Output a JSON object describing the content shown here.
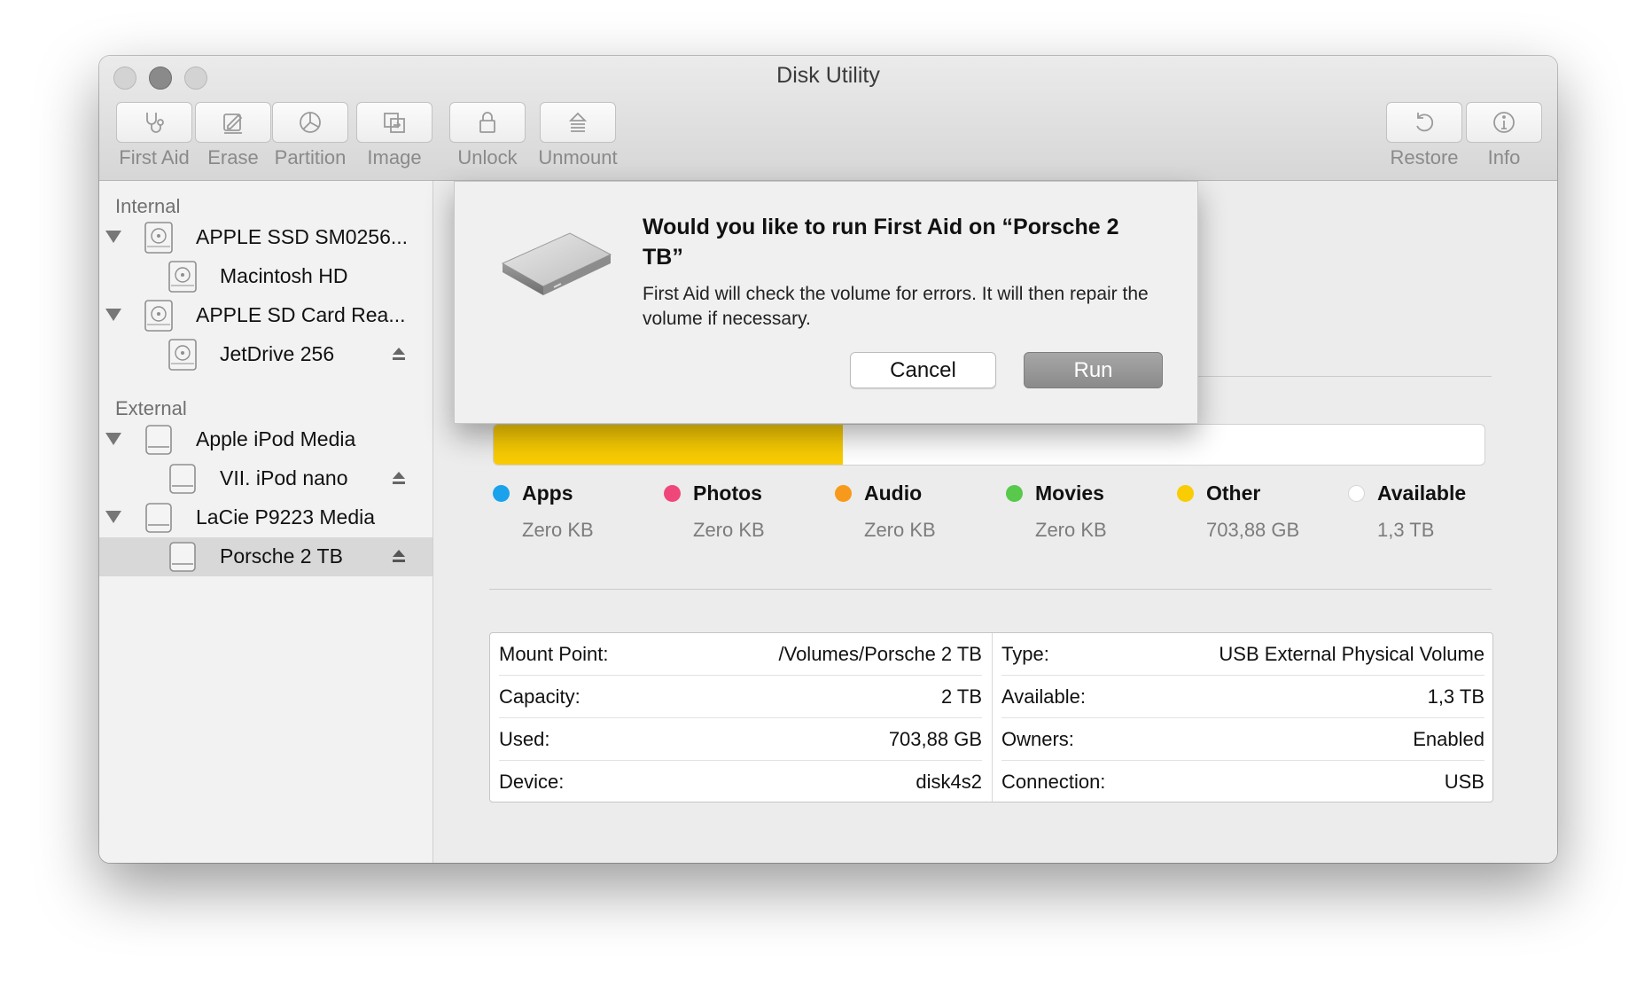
{
  "window": {
    "title": "Disk Utility"
  },
  "toolbar": {
    "first_aid": {
      "label": "First Aid",
      "icon": "stethoscope-icon"
    },
    "erase": {
      "label": "Erase",
      "icon": "erase-icon"
    },
    "partition": {
      "label": "Partition",
      "icon": "pie-chart-icon"
    },
    "image": {
      "label": "Image",
      "icon": "image-icon"
    },
    "unlock": {
      "label": "Unlock",
      "icon": "lock-icon"
    },
    "unmount": {
      "label": "Unmount",
      "icon": "eject-icon"
    },
    "restore": {
      "label": "Restore",
      "icon": "restore-icon"
    },
    "info": {
      "label": "Info",
      "icon": "info-icon"
    }
  },
  "sidebar": {
    "internal_header": "Internal",
    "external_header": "External",
    "items": [
      {
        "label": "APPLE SSD SM0256...",
        "level": 0,
        "expanded": true
      },
      {
        "label": "Macintosh HD",
        "level": 1
      },
      {
        "label": "APPLE SD Card Rea...",
        "level": 0,
        "expanded": true
      },
      {
        "label": "JetDrive 256",
        "level": 1,
        "eject": true
      },
      {
        "label": "Apple iPod Media",
        "level": 0,
        "expanded": true
      },
      {
        "label": "VII. iPod nano",
        "level": 1,
        "eject": true
      },
      {
        "label": "LaCie P9223 Media",
        "level": 0,
        "expanded": true
      },
      {
        "label": "Porsche 2 TB",
        "level": 1,
        "eject": true,
        "selected": true
      }
    ]
  },
  "usage": {
    "used_fraction": 0.352,
    "fill_color": "#f9cc03",
    "legend": [
      {
        "name": "Apps",
        "value": "Zero KB",
        "color": "#1aa2ec"
      },
      {
        "name": "Photos",
        "value": "Zero KB",
        "color": "#f0477a"
      },
      {
        "name": "Audio",
        "value": "Zero KB",
        "color": "#f79a1b"
      },
      {
        "name": "Movies",
        "value": "Zero KB",
        "color": "#58c94a"
      },
      {
        "name": "Other",
        "value": "703,88 GB",
        "color": "#f9cc03"
      },
      {
        "name": "Available",
        "value": "1,3 TB",
        "color": "#ffffff"
      }
    ]
  },
  "details": {
    "left": [
      {
        "key": "Mount Point:",
        "value": "/Volumes/Porsche 2 TB"
      },
      {
        "key": "Capacity:",
        "value": "2 TB"
      },
      {
        "key": "Used:",
        "value": "703,88 GB"
      },
      {
        "key": "Device:",
        "value": "disk4s2"
      }
    ],
    "right": [
      {
        "key": "Type:",
        "value": "USB External Physical Volume"
      },
      {
        "key": "Available:",
        "value": "1,3 TB"
      },
      {
        "key": "Owners:",
        "value": "Enabled"
      },
      {
        "key": "Connection:",
        "value": "USB"
      }
    ]
  },
  "dialog": {
    "title": "Would you like to run First Aid on “Porsche 2 TB”",
    "message": "First Aid will check the volume for errors. It will then repair the volume if necessary.",
    "cancel_label": "Cancel",
    "run_label": "Run"
  }
}
